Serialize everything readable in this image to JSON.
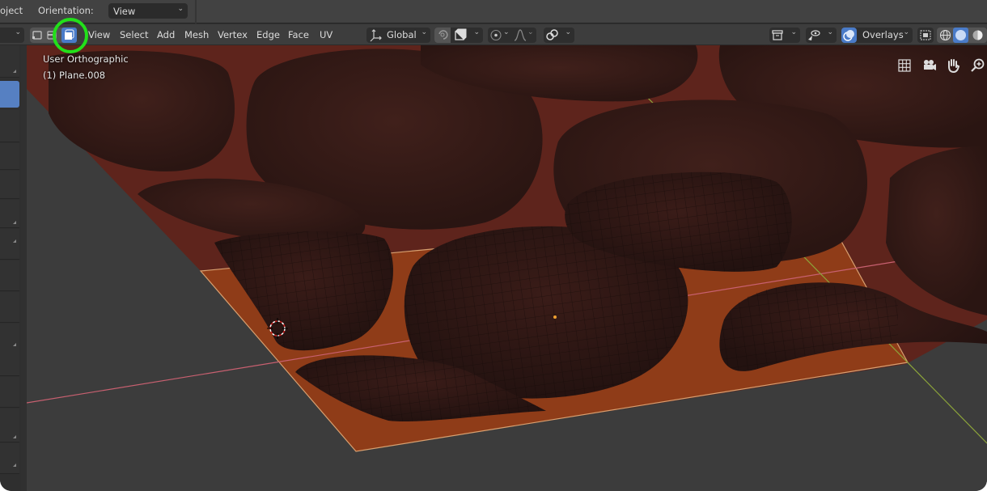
{
  "topbar": {
    "partial_label": "oject",
    "orientation_label": "Orientation:",
    "orientation_value": "View"
  },
  "header": {
    "select_modes": [
      {
        "icon": "vertex-select-icon",
        "active": false
      },
      {
        "icon": "edge-select-icon",
        "active": false
      },
      {
        "icon": "face-select-icon",
        "active": true
      }
    ],
    "menus": [
      "View",
      "Select",
      "Add",
      "Mesh",
      "Vertex",
      "Edge",
      "Face",
      "UV"
    ],
    "transform_orientation": "Global",
    "overlays_label": "Overlays",
    "accent_color": "#4a7bc8"
  },
  "viewport": {
    "view_name": "User Orthographic",
    "object_name": "(1) Plane.008",
    "nav_icons": [
      "grid-icon",
      "camera-icon",
      "hand-pan-icon",
      "zoom-icon"
    ]
  },
  "highlight": {
    "color": "#22e01a",
    "target": "face-select-mode-button"
  }
}
